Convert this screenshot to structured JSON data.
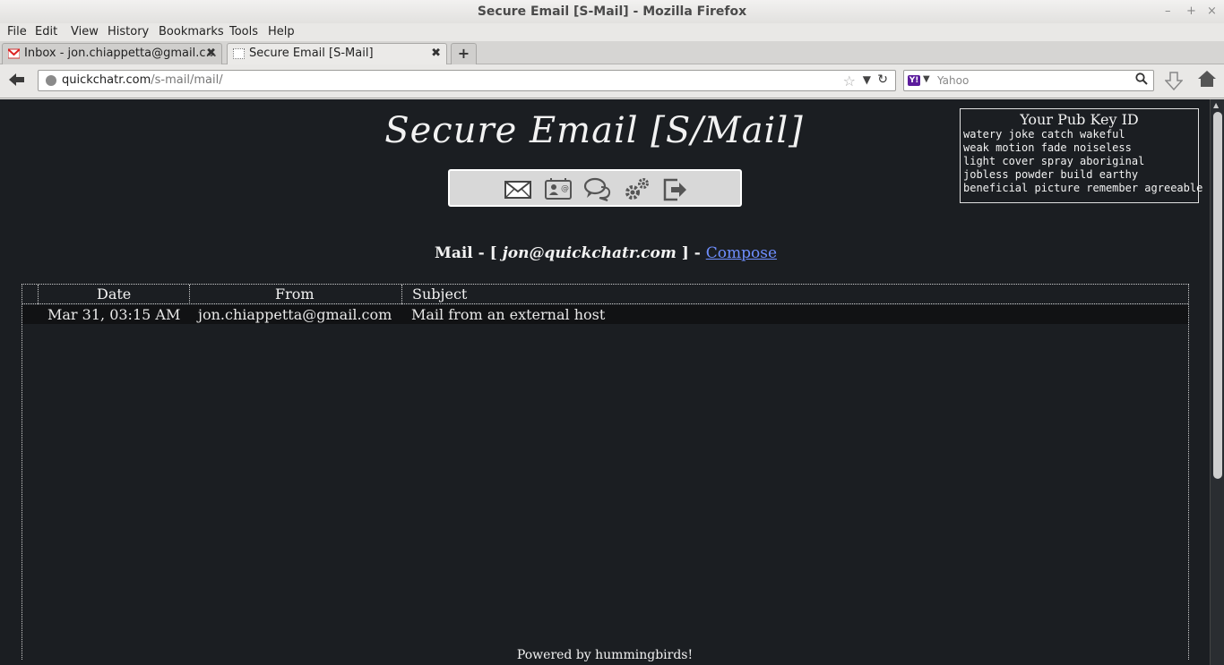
{
  "window": {
    "title": "Secure Email [S-Mail] - Mozilla Firefox",
    "controls": [
      "–",
      "+",
      "×"
    ]
  },
  "menu": [
    "File",
    "Edit",
    "View",
    "History",
    "Bookmarks",
    "Tools",
    "Help"
  ],
  "tabs": [
    {
      "label": "Inbox - jon.chiappetta@gmail.c...",
      "icon": "gmail-icon",
      "active": false
    },
    {
      "label": "Secure Email [S-Mail]",
      "icon": "blank-page-icon",
      "active": true
    }
  ],
  "tab_close": "✖",
  "new_tab": "+",
  "navbar": {
    "url_host": "quickchatr.com",
    "url_path": "/s-mail/mail/",
    "search_placeholder": "Yahoo",
    "search_engine_icon": "Y!"
  },
  "site": {
    "title": "Secure Email [S/Mail]",
    "icons": [
      "mail-icon",
      "contact-card-icon",
      "chat-bubbles-icon",
      "settings-gears-icon",
      "logout-icon"
    ]
  },
  "pubkey": {
    "title": "Your Pub Key ID",
    "lines": [
      "watery joke catch wakeful",
      "weak motion fade noiseless",
      "light cover spray aboriginal",
      "jobless powder build earthy",
      "beneficial picture remember agreeable"
    ]
  },
  "mail": {
    "prefix": "Mail - [ ",
    "address": "jon@quickchatr.com",
    "suffix": " ] - ",
    "compose": "Compose"
  },
  "table": {
    "headers": [
      "Date",
      "From",
      "Subject"
    ],
    "rows": [
      {
        "date": "Mar 31, 03:15 AM",
        "from": "jon.chiappetta@gmail.com",
        "subject": "Mail from an external host"
      }
    ]
  },
  "footer": "Powered by hummingbirds!"
}
